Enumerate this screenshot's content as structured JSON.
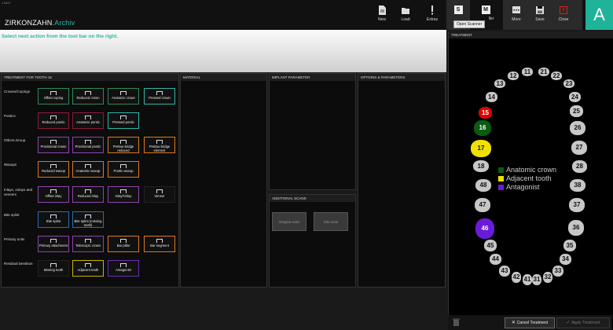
{
  "app": {
    "version": "v.5347",
    "title": "ZIRKONZAHN",
    "title_sub": ".Archiv"
  },
  "toolbar": {
    "new": "New",
    "load": "Load",
    "extras": "Extras",
    "scanner": "S",
    "scanner_tooltip": "Open Scanner",
    "m_icon": "M",
    "m_label": "ller",
    "more": "More",
    "save": "Save",
    "close": "Close"
  },
  "logo": "A",
  "instruction": "Select next action from the tool bar on the right.",
  "panels": {
    "treatment_for": "TREATMENT FOR TOOTH 15",
    "material": "MATERIAL",
    "implant": "IMPLANT PARAMETER",
    "options": "OPTIONS & PARAMETERS",
    "additional": "ADDITIONAL SCANS",
    "treatment": "TREATMENT"
  },
  "rows": [
    {
      "label": "Crowns/Copings",
      "tiles": [
        {
          "label": "Offset coping",
          "color": "#2e8b57"
        },
        {
          "label": "Reduced crown",
          "color": "#2e8b57"
        },
        {
          "label": "Anatomic crown",
          "color": "#2e8b57"
        },
        {
          "label": "Pressed crown",
          "color": "#2fb6a7"
        }
      ]
    },
    {
      "label": "Pontics",
      "tiles": [
        {
          "label": "Reduced pontic",
          "color": "#8b1a3a"
        },
        {
          "label": "Anatomic pontic",
          "color": "#8b1a3a"
        },
        {
          "label": "Pressed pontic",
          "color": "#2fb6a7"
        }
      ]
    },
    {
      "label": "Others.Group",
      "tiles": [
        {
          "label": "Provisional crown",
          "color": "#8e44ad"
        },
        {
          "label": "Provisional pontic",
          "color": "#8e44ad"
        },
        {
          "label": "Prettau-bridge reduced",
          "color": "#d97a1a"
        },
        {
          "label": "Prettau-bridge element",
          "color": "#d97a1a"
        }
      ]
    },
    {
      "label": "Waxups",
      "tiles": [
        {
          "label": "Reduced waxup",
          "color": "#d97a1a"
        },
        {
          "label": "Anatomic waxup",
          "color": "#d97a1a"
        },
        {
          "label": "Pontic waxup",
          "color": "#d97a1a"
        }
      ]
    },
    {
      "label": "Inlays, onlays and veneers",
      "tiles": [
        {
          "label": "Offset inlay",
          "color": "#8e44ad"
        },
        {
          "label": "Reduced inlay",
          "color": "#8e44ad"
        },
        {
          "label": "Inlay/Onlay",
          "color": "#8e44ad"
        },
        {
          "label": "Veneer",
          "color": "#111111"
        }
      ]
    },
    {
      "label": "Bite splint",
      "tiles": [
        {
          "label": "Bite splint",
          "color": "#2b6cb0"
        },
        {
          "label": "Bite splint (missing tooth)",
          "color": "#2b6cb0"
        }
      ]
    },
    {
      "label": "Primary units",
      "tiles": [
        {
          "label": "Primary attachment",
          "color": "#8e44ad"
        },
        {
          "label": "Telescopic crown",
          "color": "#8e44ad"
        },
        {
          "label": "Bar pillar",
          "color": "#d97a1a"
        },
        {
          "label": "Bar segment",
          "color": "#d97a1a"
        }
      ]
    },
    {
      "label": "Residual Dentition",
      "tiles": [
        {
          "label": "Missing tooth",
          "color": "#111111"
        },
        {
          "label": "Adjacent tooth",
          "color": "#c9b400"
        },
        {
          "label": "Antagonist",
          "color": "#6b2fb0"
        }
      ]
    }
  ],
  "scans": {
    "gingiva": "Gingiva scan",
    "situ": "Situ scan"
  },
  "legend": [
    {
      "label": "Anatomic crown",
      "color": "#0b5a12"
    },
    {
      "label": "Adjacent tooth",
      "color": "#f0e000"
    },
    {
      "label": "Antagonist",
      "color": "#6a1bd8"
    }
  ],
  "teeth": [
    {
      "n": "11",
      "c": "#c7c7c7"
    },
    {
      "n": "12",
      "c": "#c7c7c7"
    },
    {
      "n": "13",
      "c": "#c7c7c7"
    },
    {
      "n": "14",
      "c": "#c7c7c7"
    },
    {
      "n": "15",
      "c": "#e00000"
    },
    {
      "n": "16",
      "c": "#0b5a12"
    },
    {
      "n": "17",
      "c": "#f0e000"
    },
    {
      "n": "18",
      "c": "#c7c7c7"
    },
    {
      "n": "21",
      "c": "#c7c7c7"
    },
    {
      "n": "22",
      "c": "#c7c7c7"
    },
    {
      "n": "23",
      "c": "#c7c7c7"
    },
    {
      "n": "24",
      "c": "#c7c7c7"
    },
    {
      "n": "25",
      "c": "#c7c7c7"
    },
    {
      "n": "26",
      "c": "#c7c7c7"
    },
    {
      "n": "27",
      "c": "#c7c7c7"
    },
    {
      "n": "28",
      "c": "#c7c7c7"
    },
    {
      "n": "31",
      "c": "#c7c7c7"
    },
    {
      "n": "32",
      "c": "#c7c7c7"
    },
    {
      "n": "33",
      "c": "#c7c7c7"
    },
    {
      "n": "34",
      "c": "#c7c7c7"
    },
    {
      "n": "35",
      "c": "#c7c7c7"
    },
    {
      "n": "36",
      "c": "#c7c7c7"
    },
    {
      "n": "37",
      "c": "#c7c7c7"
    },
    {
      "n": "38",
      "c": "#c7c7c7"
    },
    {
      "n": "41",
      "c": "#c7c7c7"
    },
    {
      "n": "42",
      "c": "#c7c7c7"
    },
    {
      "n": "43",
      "c": "#c7c7c7"
    },
    {
      "n": "44",
      "c": "#c7c7c7"
    },
    {
      "n": "45",
      "c": "#c7c7c7"
    },
    {
      "n": "46",
      "c": "#6a1bd8"
    },
    {
      "n": "47",
      "c": "#c7c7c7"
    },
    {
      "n": "48",
      "c": "#c7c7c7"
    }
  ],
  "footer": {
    "cancel": "Cancel Treatment",
    "apply": "Apply Treatment"
  }
}
